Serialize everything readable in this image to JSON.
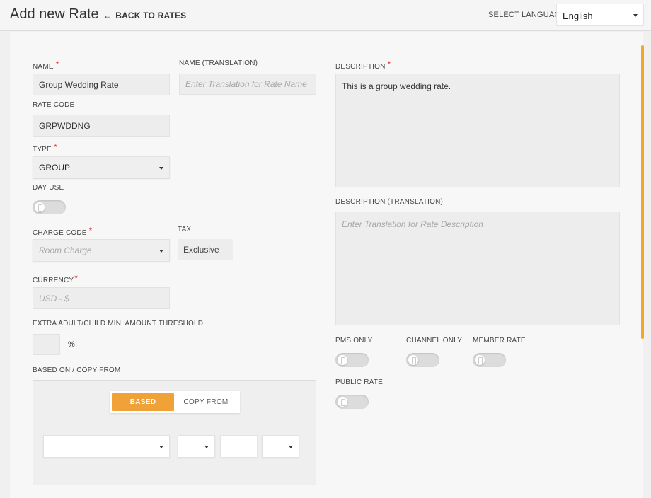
{
  "header": {
    "title": "Add new Rate",
    "back_label": "BACK TO RATES",
    "language_label": "SELECT LANGUAGE",
    "language_value": "English"
  },
  "form": {
    "name": {
      "label": "NAME",
      "value": "Group Wedding Rate"
    },
    "name_translation": {
      "label": "NAME (TRANSLATION)",
      "placeholder": "Enter Translation for Rate Name"
    },
    "rate_code": {
      "label": "RATE CODE",
      "value": "GRPWDDNG"
    },
    "type": {
      "label": "TYPE",
      "value": "GROUP"
    },
    "day_use": {
      "label": "DAY USE",
      "on": false
    },
    "charge_code": {
      "label": "CHARGE CODE",
      "placeholder": "Room Charge"
    },
    "tax": {
      "label": "TAX",
      "value": "Exclusive"
    },
    "currency": {
      "label": "CURRENCY",
      "placeholder": "USD - $"
    },
    "threshold": {
      "label": "EXTRA ADULT/CHILD MIN. AMOUNT THRESHOLD",
      "unit": "%"
    },
    "based_on": {
      "label": "BASED ON / COPY FROM",
      "based_label": "BASED",
      "copy_label": "COPY FROM",
      "active": "BASED"
    },
    "description": {
      "label": "DESCRIPTION",
      "value": "This is a group wedding rate."
    },
    "description_translation": {
      "label": "DESCRIPTION (TRANSLATION)",
      "placeholder": "Enter Translation for Rate Description"
    },
    "toggles": {
      "pms_only": {
        "label": "PMS ONLY",
        "on": false
      },
      "channel_only": {
        "label": "CHANNEL ONLY",
        "on": false
      },
      "member_rate": {
        "label": "MEMBER RATE",
        "on": false
      },
      "public_rate": {
        "label": "PUBLIC RATE",
        "on": false
      }
    }
  },
  "colors": {
    "accent": "#f0a137",
    "required": "#e53935",
    "scrollbar": "#f5a623"
  }
}
